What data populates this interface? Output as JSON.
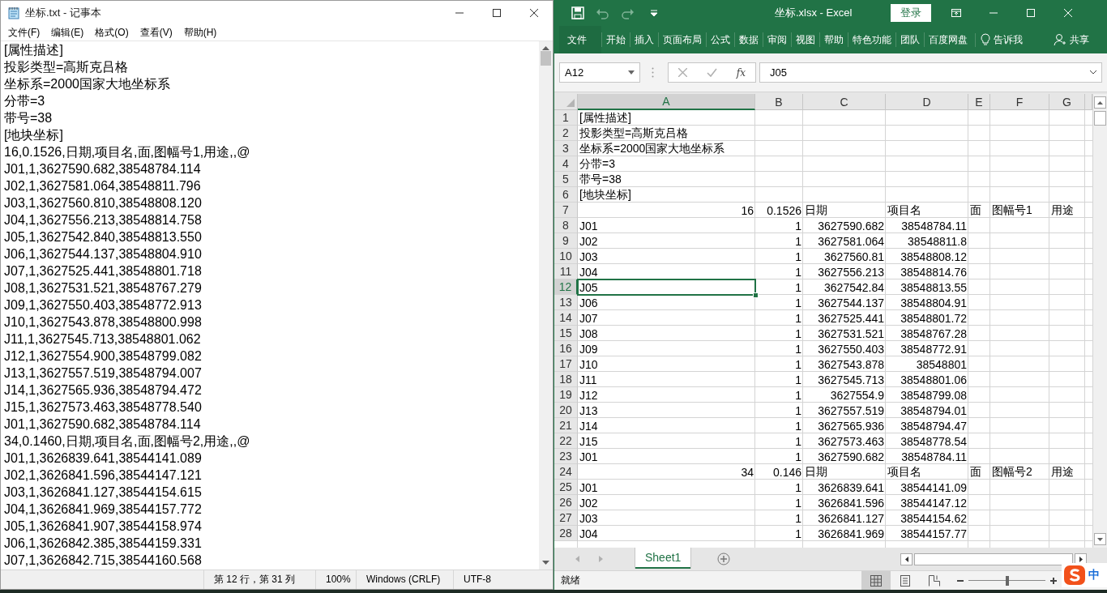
{
  "notepad": {
    "title": "坐标.txt - 记事本",
    "menu": [
      "文件(F)",
      "编辑(E)",
      "格式(O)",
      "查看(V)",
      "帮助(H)"
    ],
    "lines": [
      "[属性描述]",
      "投影类型=高斯克吕格",
      "坐标系=2000国家大地坐标系",
      "分带=3",
      "带号=38",
      "[地块坐标]",
      "16,0.1526,日期,项目名,面,图幅号1,用途,,@",
      "J01,1,3627590.682,38548784.114",
      "J02,1,3627581.064,38548811.796",
      "J03,1,3627560.810,38548808.120",
      "J04,1,3627556.213,38548814.758",
      "J05,1,3627542.840,38548813.550",
      "J06,1,3627544.137,38548804.910",
      "J07,1,3627525.441,38548801.718",
      "J08,1,3627531.521,38548767.279",
      "J09,1,3627550.403,38548772.913",
      "J10,1,3627543.878,38548800.998",
      "J11,1,3627545.713,38548801.062",
      "J12,1,3627554.900,38548799.082",
      "J13,1,3627557.519,38548794.007",
      "J14,1,3627565.936,38548794.472",
      "J15,1,3627573.463,38548778.540",
      "J01,1,3627590.682,38548784.114",
      "34,0.1460,日期,项目名,面,图幅号2,用途,,@",
      "J01,1,3626839.641,38544141.089",
      "J02,1,3626841.596,38544147.121",
      "J03,1,3626841.127,38544154.615",
      "J04,1,3626841.969,38544157.772",
      "J05,1,3626841.907,38544158.974",
      "J06,1,3626842.385,38544159.331",
      "J07,1,3626842.715,38544160.568"
    ],
    "status": [
      "第 12 行，第 31 列",
      "100%",
      "Windows (CRLF)",
      "UTF-8"
    ]
  },
  "excel": {
    "title": "坐标.xlsx - Excel",
    "sign_in": "登录",
    "tabs": [
      {
        "label": "文件",
        "selected": false
      },
      {
        "label": "开始",
        "selected": false
      },
      {
        "label": "插入",
        "selected": false
      },
      {
        "label": "页面布局",
        "selected": false
      },
      {
        "label": "公式",
        "selected": false
      },
      {
        "label": "数据",
        "selected": false
      },
      {
        "label": "审阅",
        "selected": false
      },
      {
        "label": "视图",
        "selected": false
      },
      {
        "label": "帮助",
        "selected": false
      },
      {
        "label": "特色功能",
        "selected": false
      },
      {
        "label": "团队",
        "selected": false
      },
      {
        "label": "百度网盘",
        "selected": false
      }
    ],
    "tell_me": "告诉我",
    "share": "共享",
    "name_box": "A12",
    "fx": "fx",
    "formula": "J05",
    "columns": [
      {
        "label": "A",
        "selected": true
      },
      {
        "label": "B",
        "selected": false
      },
      {
        "label": "C",
        "selected": false
      },
      {
        "label": "D",
        "selected": false
      },
      {
        "label": "E",
        "selected": false
      },
      {
        "label": "F",
        "selected": false
      },
      {
        "label": "G",
        "selected": false
      }
    ],
    "rows": [
      {
        "row": "1",
        "selected": false,
        "cells": [
          {
            "t": "[属性描述]"
          }
        ]
      },
      {
        "row": "2",
        "selected": false,
        "cells": [
          {
            "t": "投影类型=高斯克吕格"
          }
        ]
      },
      {
        "row": "3",
        "selected": false,
        "cells": [
          {
            "t": "坐标系=2000国家大地坐标系"
          }
        ]
      },
      {
        "row": "4",
        "selected": false,
        "cells": [
          {
            "t": "分带=3"
          }
        ]
      },
      {
        "row": "5",
        "selected": false,
        "cells": [
          {
            "t": "带号=38"
          }
        ]
      },
      {
        "row": "6",
        "selected": false,
        "cells": [
          {
            "t": "[地块坐标]"
          }
        ]
      },
      {
        "row": "7",
        "selected": false,
        "cells": [
          {
            "n": "16"
          },
          {
            "n": "0.1526"
          },
          {
            "t": "日期"
          },
          {
            "t": "项目名"
          },
          {
            "t": "面"
          },
          {
            "t": "图幅号1"
          },
          {
            "t": "用途"
          }
        ]
      },
      {
        "row": "8",
        "selected": false,
        "cells": [
          {
            "t": "J01"
          },
          {
            "n": "1"
          },
          {
            "n": "3627590.682"
          },
          {
            "n": "38548784.11"
          }
        ]
      },
      {
        "row": "9",
        "selected": false,
        "cells": [
          {
            "t": "J02"
          },
          {
            "n": "1"
          },
          {
            "n": "3627581.064"
          },
          {
            "n": "38548811.8"
          }
        ]
      },
      {
        "row": "10",
        "selected": false,
        "cells": [
          {
            "t": "J03"
          },
          {
            "n": "1"
          },
          {
            "n": "3627560.81"
          },
          {
            "n": "38548808.12"
          }
        ]
      },
      {
        "row": "11",
        "selected": false,
        "cells": [
          {
            "t": "J04"
          },
          {
            "n": "1"
          },
          {
            "n": "3627556.213"
          },
          {
            "n": "38548814.76"
          }
        ]
      },
      {
        "row": "12",
        "selected": true,
        "cells": [
          {
            "t": "J05"
          },
          {
            "n": "1"
          },
          {
            "n": "3627542.84"
          },
          {
            "n": "38548813.55"
          }
        ]
      },
      {
        "row": "13",
        "selected": false,
        "cells": [
          {
            "t": "J06"
          },
          {
            "n": "1"
          },
          {
            "n": "3627544.137"
          },
          {
            "n": "38548804.91"
          }
        ]
      },
      {
        "row": "14",
        "selected": false,
        "cells": [
          {
            "t": "J07"
          },
          {
            "n": "1"
          },
          {
            "n": "3627525.441"
          },
          {
            "n": "38548801.72"
          }
        ]
      },
      {
        "row": "15",
        "selected": false,
        "cells": [
          {
            "t": "J08"
          },
          {
            "n": "1"
          },
          {
            "n": "3627531.521"
          },
          {
            "n": "38548767.28"
          }
        ]
      },
      {
        "row": "16",
        "selected": false,
        "cells": [
          {
            "t": "J09"
          },
          {
            "n": "1"
          },
          {
            "n": "3627550.403"
          },
          {
            "n": "38548772.91"
          }
        ]
      },
      {
        "row": "17",
        "selected": false,
        "cells": [
          {
            "t": "J10"
          },
          {
            "n": "1"
          },
          {
            "n": "3627543.878"
          },
          {
            "n": "38548801"
          }
        ]
      },
      {
        "row": "18",
        "selected": false,
        "cells": [
          {
            "t": "J11"
          },
          {
            "n": "1"
          },
          {
            "n": "3627545.713"
          },
          {
            "n": "38548801.06"
          }
        ]
      },
      {
        "row": "19",
        "selected": false,
        "cells": [
          {
            "t": "J12"
          },
          {
            "n": "1"
          },
          {
            "n": "3627554.9"
          },
          {
            "n": "38548799.08"
          }
        ]
      },
      {
        "row": "20",
        "selected": false,
        "cells": [
          {
            "t": "J13"
          },
          {
            "n": "1"
          },
          {
            "n": "3627557.519"
          },
          {
            "n": "38548794.01"
          }
        ]
      },
      {
        "row": "21",
        "selected": false,
        "cells": [
          {
            "t": "J14"
          },
          {
            "n": "1"
          },
          {
            "n": "3627565.936"
          },
          {
            "n": "38548794.47"
          }
        ]
      },
      {
        "row": "22",
        "selected": false,
        "cells": [
          {
            "t": "J15"
          },
          {
            "n": "1"
          },
          {
            "n": "3627573.463"
          },
          {
            "n": "38548778.54"
          }
        ]
      },
      {
        "row": "23",
        "selected": false,
        "cells": [
          {
            "t": "J01"
          },
          {
            "n": "1"
          },
          {
            "n": "3627590.682"
          },
          {
            "n": "38548784.11"
          }
        ]
      },
      {
        "row": "24",
        "selected": false,
        "cells": [
          {
            "n": "34"
          },
          {
            "n": "0.146"
          },
          {
            "t": "日期"
          },
          {
            "t": "项目名"
          },
          {
            "t": "面"
          },
          {
            "t": "图幅号2"
          },
          {
            "t": "用途"
          }
        ]
      },
      {
        "row": "25",
        "selected": false,
        "cells": [
          {
            "t": "J01"
          },
          {
            "n": "1"
          },
          {
            "n": "3626839.641"
          },
          {
            "n": "38544141.09"
          }
        ]
      },
      {
        "row": "26",
        "selected": false,
        "cells": [
          {
            "t": "J02"
          },
          {
            "n": "1"
          },
          {
            "n": "3626841.596"
          },
          {
            "n": "38544147.12"
          }
        ]
      },
      {
        "row": "27",
        "selected": false,
        "cells": [
          {
            "t": "J03"
          },
          {
            "n": "1"
          },
          {
            "n": "3626841.127"
          },
          {
            "n": "38544154.62"
          }
        ]
      },
      {
        "row": "28",
        "selected": false,
        "cells": [
          {
            "t": "J04"
          },
          {
            "n": "1"
          },
          {
            "n": "3626841.969"
          },
          {
            "n": "38544157.77"
          }
        ]
      }
    ],
    "sheets": [
      {
        "label": "Sheet1",
        "selected": true
      }
    ],
    "status": "就绪",
    "zoom_slider": {
      "level": 0.5
    },
    "ime": "中"
  }
}
